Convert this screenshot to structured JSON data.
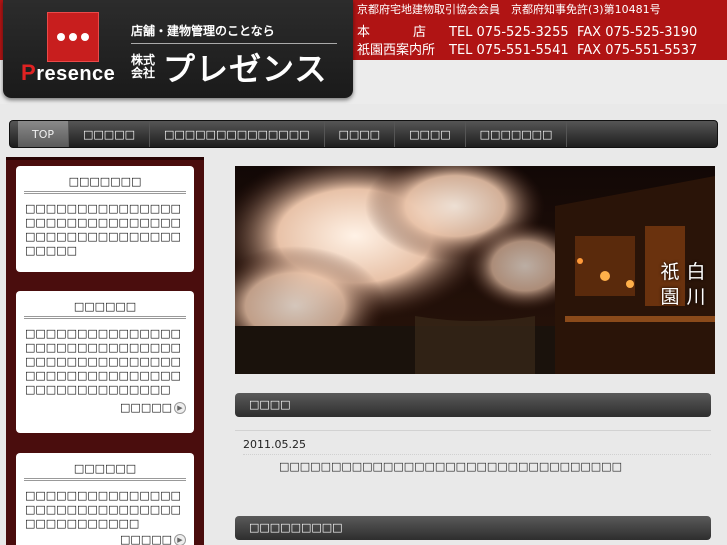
{
  "header": {
    "logo_word_initial": "P",
    "logo_word_rest": "resence",
    "tagline": "店舗・建物管理のことなら",
    "company_type": "株式会社",
    "company_name": "プレゼンス",
    "contact_top": "京都府宅地建物取引協会会員　京都府知事免許(3)第10481号",
    "offices": [
      {
        "label": "本　　　店",
        "tel": "TEL 075-525-3255",
        "fax": "FAX 075-525-3190"
      },
      {
        "label": "祇園西案内所",
        "tel": "TEL 075-551-5541",
        "fax": "FAX 075-551-5537"
      }
    ]
  },
  "nav": {
    "items": [
      "TOP",
      "□□□□□",
      "□□□□□□□□□□□□□□",
      "□□□□",
      "□□□□",
      "□□□□□□□"
    ]
  },
  "sidebar": {
    "boxes": [
      {
        "title": "□□□□□□□",
        "body": "□□□□□□□□□□□□□□□□□□□□□□□□□□□□□□□□□□□□□□□□□□□□□□□□□□",
        "more": ""
      },
      {
        "title": "□□□□□□",
        "body": "□□□□□□□□□□□□□□□□□□□□□□□□□□□□□□□□□□□□□□□□□□□□□□□□□□□□□□□□□□□□□□□□□□□□□□□□□□",
        "more": "□□□□□"
      },
      {
        "title": "□□□□□□",
        "body": "□□□□□□□□□□□□□□□□□□□□□□□□□□□□□□□□□□□□□□□□□",
        "more": "□□□□□"
      }
    ]
  },
  "hero": {
    "caption_left": "祇園",
    "caption_right": "白川"
  },
  "news": {
    "title": "□□□□",
    "date": "2011.05.25",
    "text": "□□□□□□□□□□□□□□□□□□□□□□□□□□□□□□□□□"
  },
  "section2": {
    "title": "□□□□□□□□□"
  },
  "colors": {
    "brand_red": "#b01414",
    "sidebar_bg": "#4a0d0d",
    "nav_dark": "#1e1e1e"
  }
}
